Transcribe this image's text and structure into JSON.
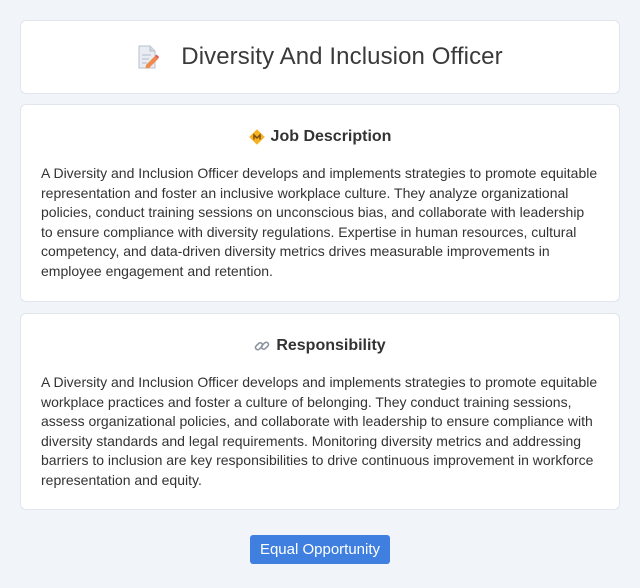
{
  "header": {
    "icon": "document-pencil-icon",
    "title": "Diversity And Inclusion Officer"
  },
  "job_description": {
    "icon": "diamond-badge-icon",
    "title": "Job Description",
    "text": "A Diversity and Inclusion Officer develops and implements strategies to promote equitable representation and foster an inclusive workplace culture. They analyze organizational policies, conduct training sessions on unconscious bias, and collaborate with leadership to ensure compliance with diversity regulations. Expertise in human resources, cultural competency, and data-driven diversity metrics drives measurable improvements in employee engagement and retention."
  },
  "responsibility": {
    "icon": "link-icon",
    "title": "Responsibility",
    "text": "A Diversity and Inclusion Officer develops and implements strategies to promote equitable workplace practices and foster a culture of belonging. They conduct training sessions, assess organizational policies, and collaborate with leadership to ensure compliance with diversity standards and legal requirements. Monitoring diversity metrics and addressing barriers to inclusion are key responsibilities to drive continuous improvement in workforce representation and equity."
  },
  "tag": {
    "label": "Equal Opportunity",
    "color": "#3f7fe0"
  }
}
